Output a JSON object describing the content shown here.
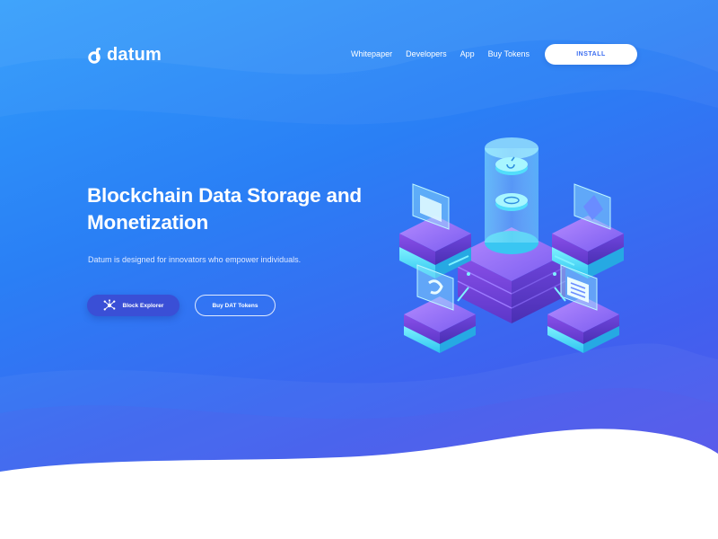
{
  "brand": {
    "name": "datum",
    "accent": "#2f8cf8",
    "button_dark": "#3a4fd6"
  },
  "nav": {
    "links": [
      "Whitepaper",
      "Developers",
      "App",
      "Buy Tokens"
    ],
    "install_label": "INSTALL"
  },
  "hero": {
    "title": "Blockchain Data Storage and Monetization",
    "subtitle": "Datum is designed for innovators who empower individuals.",
    "primary_button": "Block Explorer",
    "primary_button_icon": "network-icon",
    "secondary_button": "Buy DAT Tokens"
  }
}
